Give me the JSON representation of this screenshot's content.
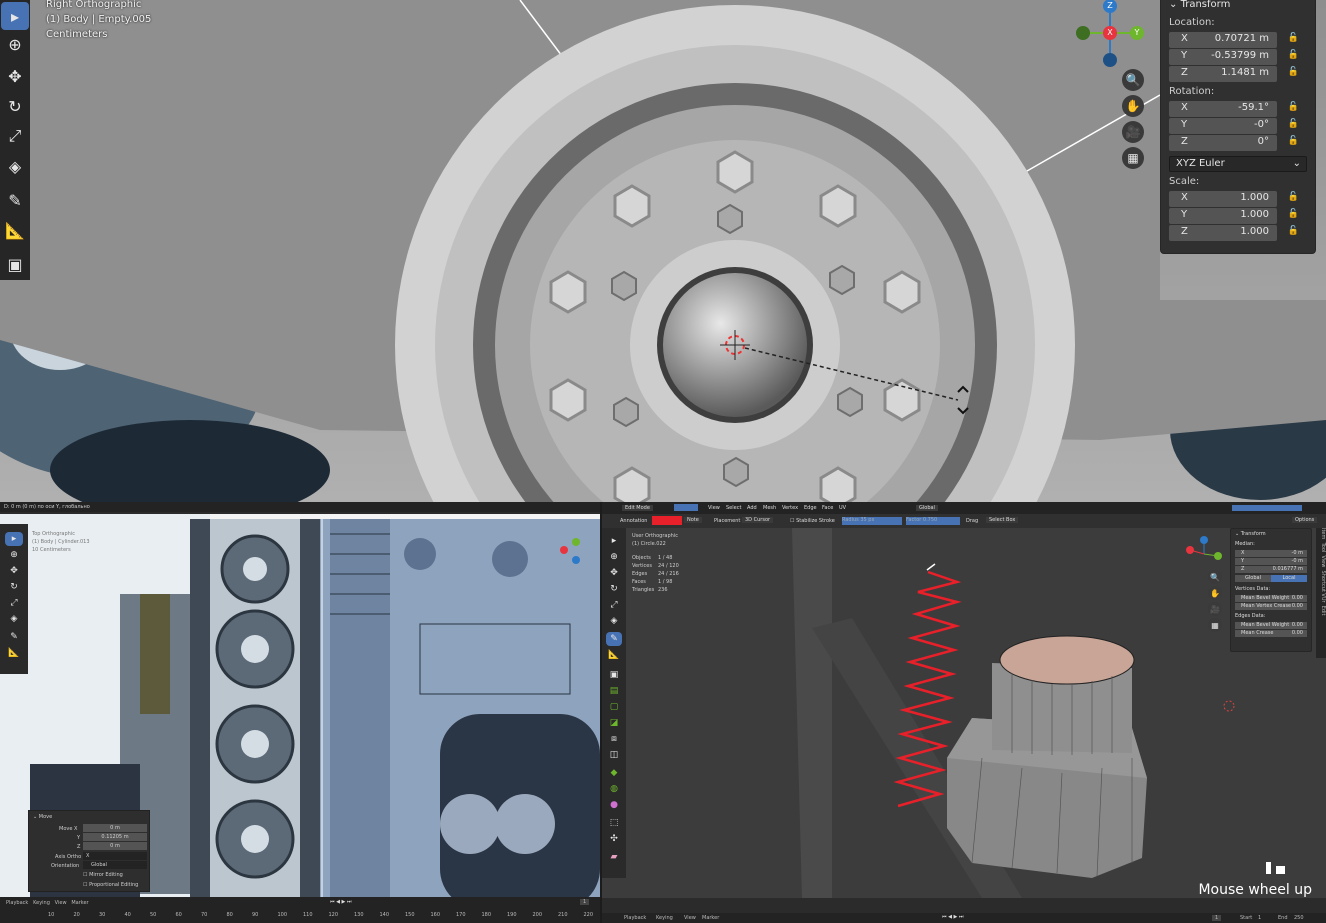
{
  "top": {
    "overlay": {
      "view": "Right Orthographic",
      "object": "(1) Body | Empty.005",
      "units": "Centimeters"
    },
    "transform": {
      "title": "Transform",
      "location_label": "Location:",
      "location": [
        {
          "axis": "X",
          "value": "0.70721 m"
        },
        {
          "axis": "Y",
          "value": "-0.53799 m"
        },
        {
          "axis": "Z",
          "value": "1.1481 m"
        }
      ],
      "rotation_label": "Rotation:",
      "rotation": [
        {
          "axis": "X",
          "value": "-59.1°"
        },
        {
          "axis": "Y",
          "value": "-0°"
        },
        {
          "axis": "Z",
          "value": "0°"
        }
      ],
      "mode": "XYZ Euler",
      "scale_label": "Scale:",
      "scale": [
        {
          "axis": "X",
          "value": "1.000"
        },
        {
          "axis": "Y",
          "value": "1.000"
        },
        {
          "axis": "Z",
          "value": "1.000"
        }
      ]
    },
    "gizmo": {
      "z": "Z",
      "x": "X",
      "y": "Y"
    }
  },
  "bl": {
    "header": "D: 0 m (0 m) по оси Y, глобально",
    "overlay": {
      "view": "Top Orthographic",
      "object": "(1) Body | Cylinder.013",
      "units": "10 Centimeters"
    },
    "move_panel": {
      "title": "Move",
      "move_x_label": "Move X",
      "move_x": "0 m",
      "y_label": "Y",
      "y": "0.11205 m",
      "z_label": "Z",
      "z": "0 m",
      "axis_ortho_label": "Axis Ortho",
      "axis_ortho": "X",
      "orientation_label": "Orientation",
      "orientation": "Global",
      "mirror": "Mirror Editing",
      "proportional": "Proportional Editing"
    },
    "timeline": {
      "menus": [
        "Playback",
        "Keying",
        "View",
        "Marker"
      ],
      "frame": "1",
      "ticks": [
        "10",
        "20",
        "30",
        "40",
        "50",
        "60",
        "70",
        "80",
        "90",
        "100",
        "110",
        "120",
        "130",
        "140",
        "150",
        "160",
        "170",
        "180",
        "190",
        "200",
        "210",
        "220"
      ]
    }
  },
  "br": {
    "mode": "Edit Mode",
    "menus": [
      "View",
      "Select",
      "Add",
      "Mesh",
      "Vertex",
      "Edge",
      "Face",
      "UV"
    ],
    "orientation": "Global",
    "options": "Options",
    "tool_header": {
      "annotation": "Annotation",
      "note": "Note",
      "placement": "Placement",
      "cursor": "3D Cursor",
      "stabilize": "Stabilize Stroke",
      "radius": "Radius",
      "radius_val": "35 px",
      "factor": "Factor",
      "factor_val": "0.750",
      "drag": "Drag",
      "select_box": "Select Box"
    },
    "overlay": {
      "view": "User Orthographic",
      "object": "(1) Circle.022"
    },
    "stats": [
      {
        "label": "Objects",
        "value": "1 / 48"
      },
      {
        "label": "Vertices",
        "value": "24 / 120"
      },
      {
        "label": "Edges",
        "value": "24 / 216"
      },
      {
        "label": "Faces",
        "value": "1 / 98"
      },
      {
        "label": "Triangles",
        "value": "236"
      }
    ],
    "transform": {
      "title": "Transform",
      "median": "Median:",
      "rows": [
        {
          "axis": "X",
          "value": "-0 m"
        },
        {
          "axis": "Y",
          "value": "-0 m"
        },
        {
          "axis": "Z",
          "value": "0.016777 m"
        }
      ],
      "global": "Global",
      "local": "Local",
      "vertices_data": "Vertices Data:",
      "mean_bevel_weight": "Mean Bevel Weight",
      "mbw_val": "0.00",
      "mean_vertex_crease": "Mean Vertex Crease",
      "mvc_val": "0.00",
      "edges_data": "Edges Data:",
      "edge_bevel": "Mean Bevel Weight",
      "eb_val": "0.00",
      "mean_crease": "Mean Crease",
      "mc_val": "0.00"
    },
    "sidetabs": [
      "Item",
      "Tool",
      "View",
      "Shortcut VUr",
      "Edit"
    ],
    "keycast": "Mouse wheel up",
    "timeline": {
      "menus": [
        "Playback",
        "Keying",
        "View",
        "Marker"
      ],
      "frame": "1",
      "start_label": "Start",
      "start": "1",
      "end_label": "End",
      "end": "250"
    }
  },
  "colors": {
    "accent": "#4772b3",
    "annotation": "#e8202a",
    "x_axis": "#e8343f",
    "y_axis": "#6eb62c",
    "z_axis": "#2c7ac9"
  }
}
